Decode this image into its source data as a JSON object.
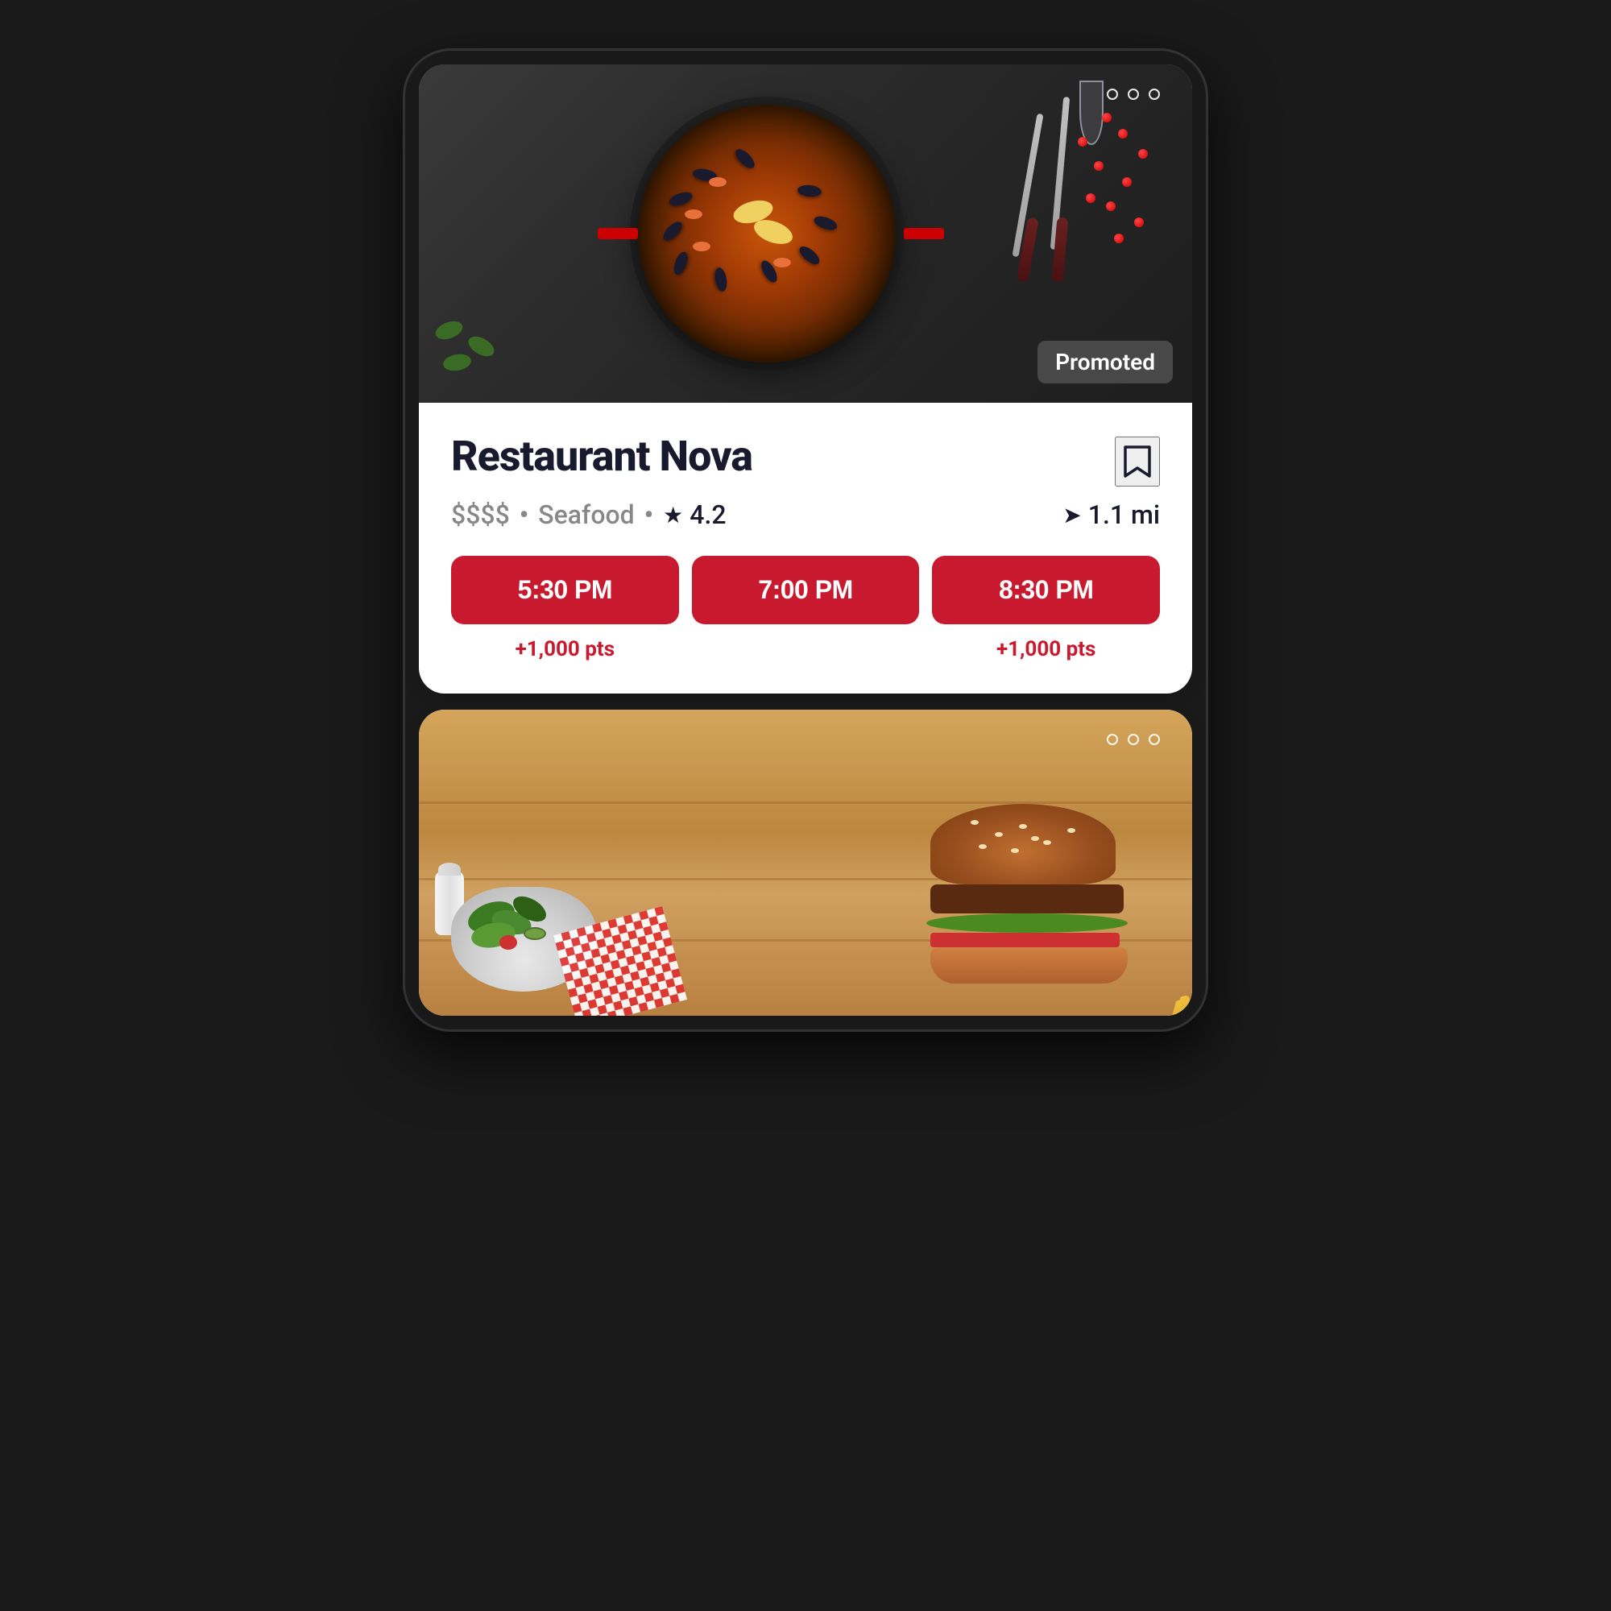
{
  "card1": {
    "promoted_badge": "Promoted",
    "restaurant_name": "Restaurant Nova",
    "price": "$$$$",
    "separator1": "•",
    "cuisine": "Seafood",
    "separator2": "•",
    "rating": "4.2",
    "distance": "1.1 mi",
    "time_slots": [
      "5:30 PM",
      "7:00 PM",
      "8:30 PM"
    ],
    "points": [
      "+1,000 pts",
      "",
      "+1,000 pts"
    ],
    "dots": [
      "",
      "",
      ""
    ]
  },
  "card2": {
    "dots": [
      "",
      "",
      ""
    ]
  },
  "icons": {
    "bookmark": "bookmark-icon",
    "star": "★",
    "navigation": "➤"
  }
}
